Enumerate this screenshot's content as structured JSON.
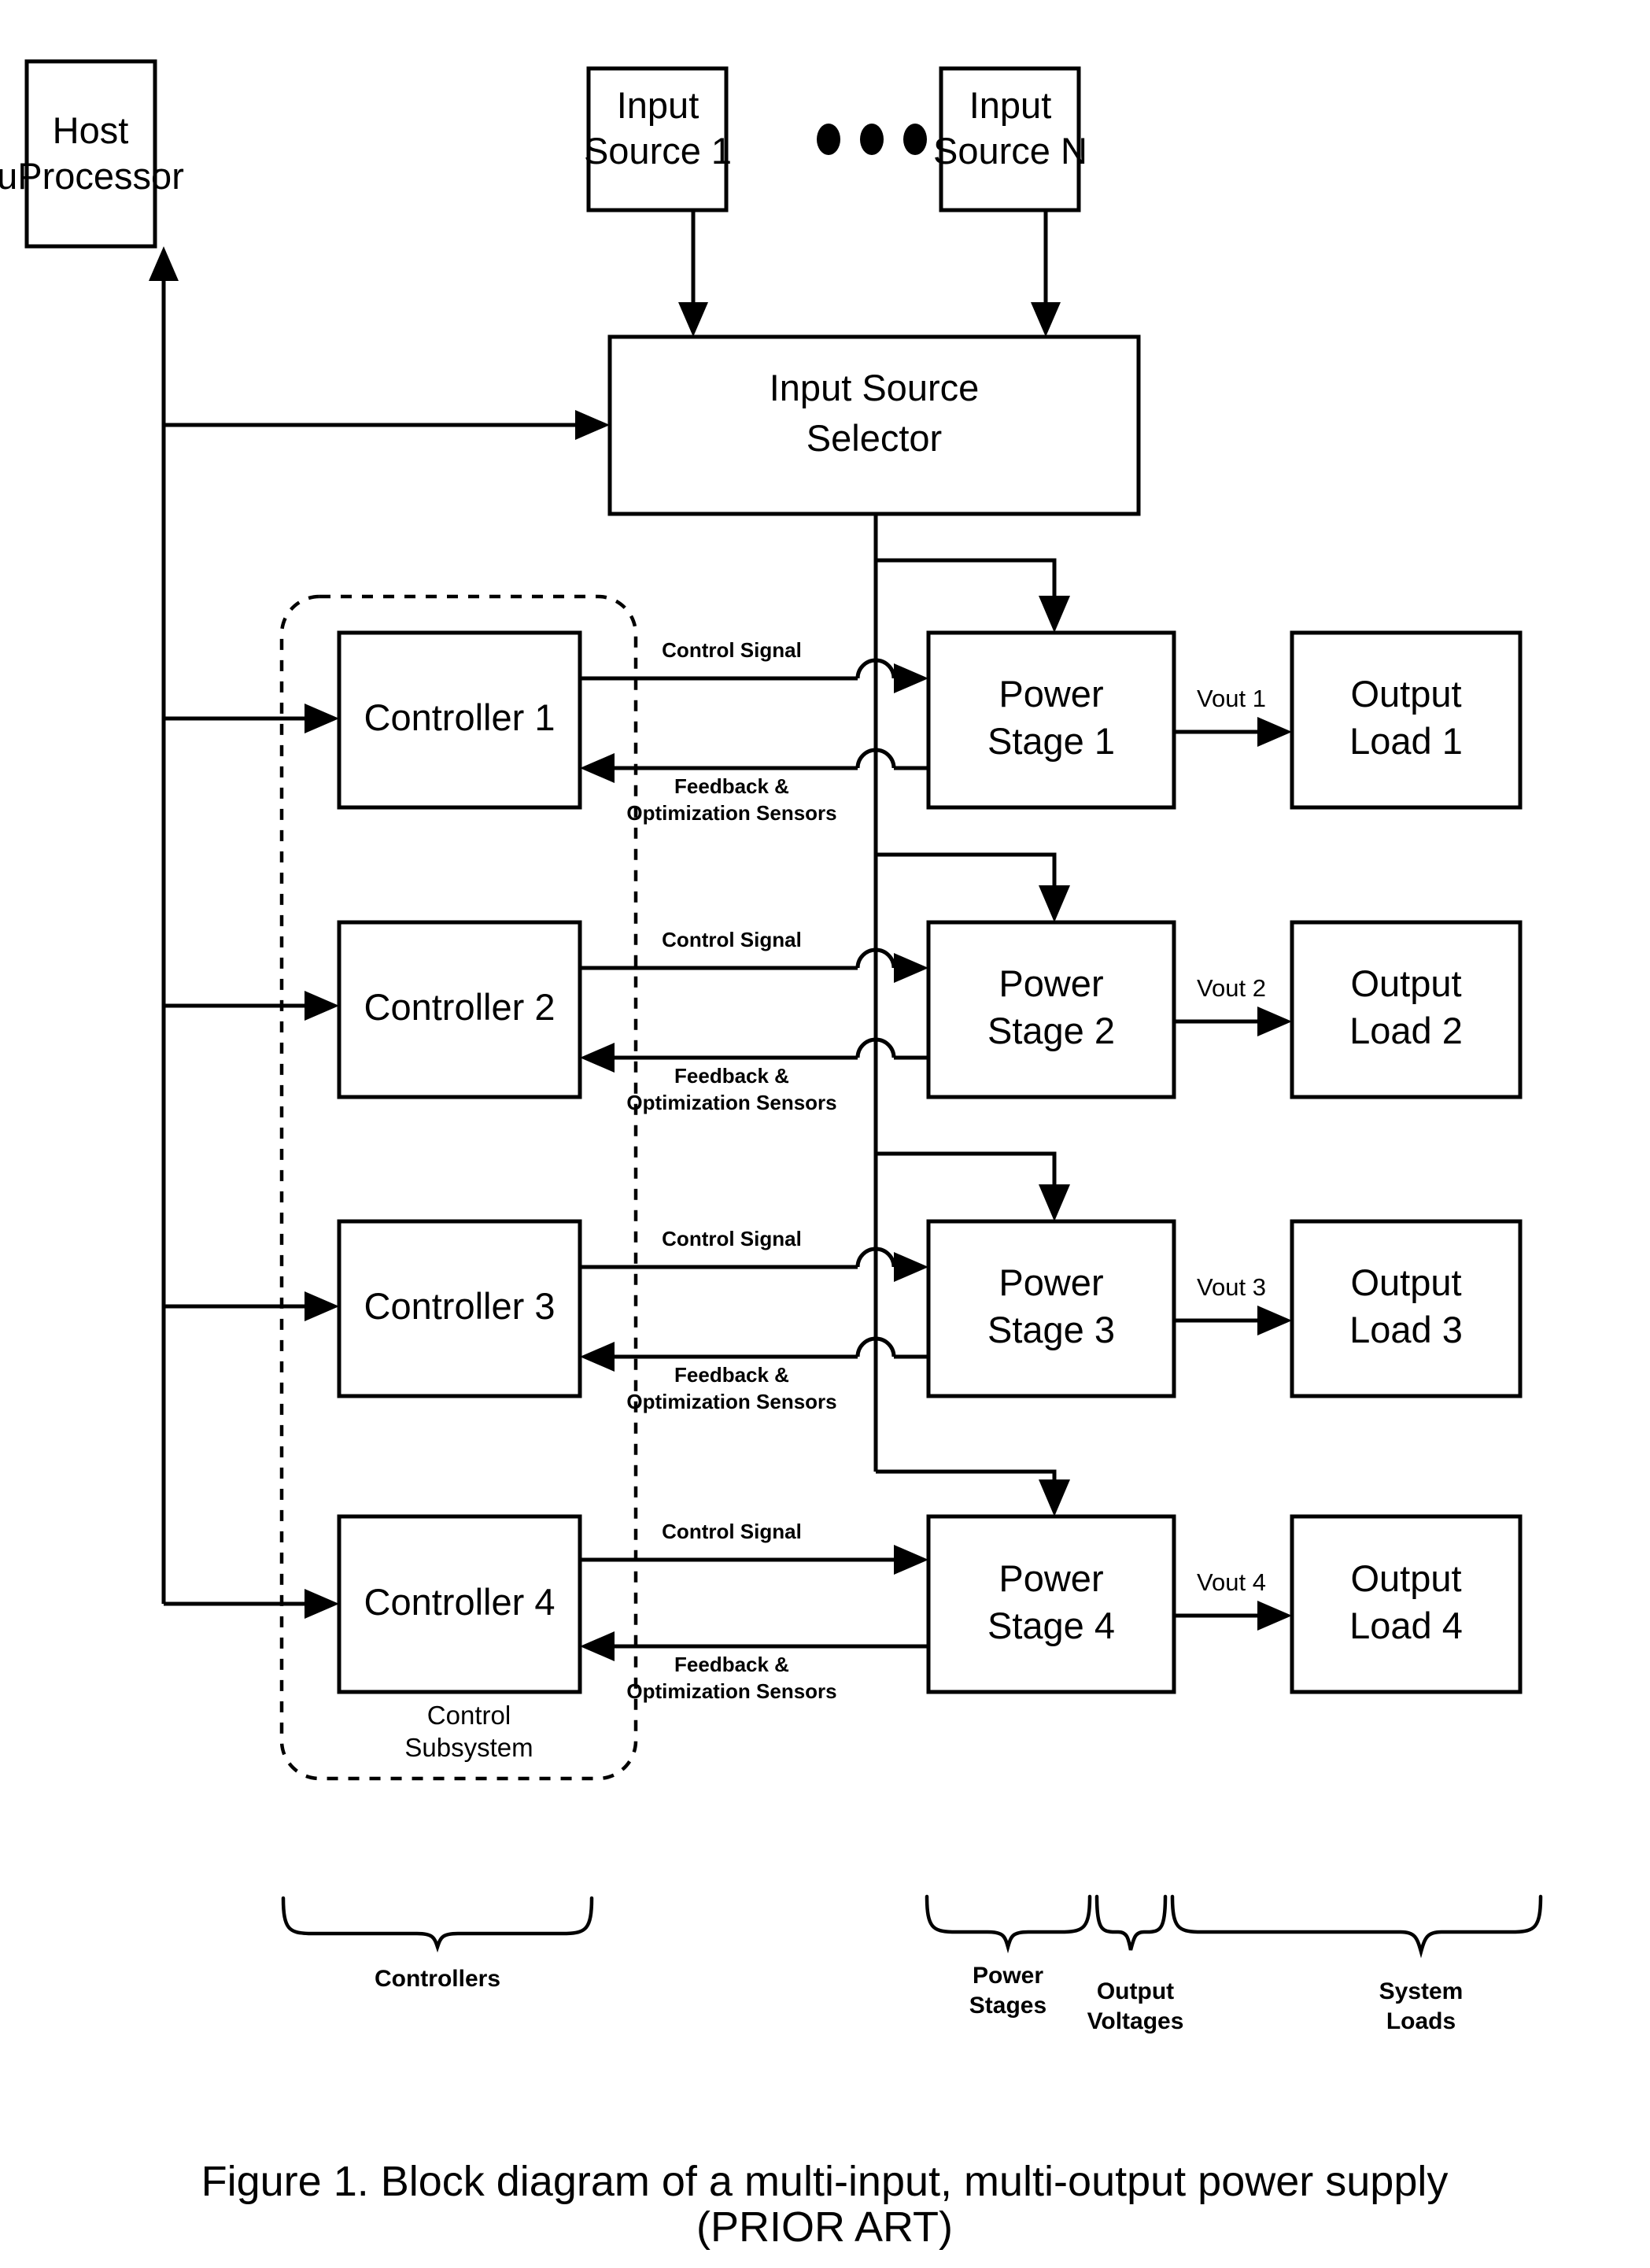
{
  "figure": {
    "caption_line1": "Figure 1.  Block diagram of a multi-input, multi-output power supply",
    "caption_line2": "(PRIOR ART)"
  },
  "blocks": {
    "host": {
      "line1": "Host",
      "line2": "uProcessor"
    },
    "input_source_first": {
      "line1": "Input",
      "line2": "Source 1"
    },
    "input_source_last": {
      "line1": "Input",
      "line2": "Source N"
    },
    "selector": {
      "line1": "Input Source",
      "line2": "Selector"
    },
    "ellipsis": "• • •"
  },
  "channels": [
    {
      "controller": "Controller 1",
      "power_stage_line1": "Power",
      "power_stage_line2": "Stage 1",
      "output_load_line1": "Output",
      "output_load_line2": "Load 1",
      "vout": "Vout 1",
      "control_signal": "Control Signal",
      "feedback_line1": "Feedback &",
      "feedback_line2": "Optimization Sensors"
    },
    {
      "controller": "Controller 2",
      "power_stage_line1": "Power",
      "power_stage_line2": "Stage 2",
      "output_load_line1": "Output",
      "output_load_line2": "Load 2",
      "vout": "Vout 2",
      "control_signal": "Control Signal",
      "feedback_line1": "Feedback &",
      "feedback_line2": "Optimization Sensors"
    },
    {
      "controller": "Controller 3",
      "power_stage_line1": "Power",
      "power_stage_line2": "Stage 3",
      "output_load_line1": "Output",
      "output_load_line2": "Load 3",
      "vout": "Vout 3",
      "control_signal": "Control Signal",
      "feedback_line1": "Feedback &",
      "feedback_line2": "Optimization Sensors"
    },
    {
      "controller": "Controller 4",
      "power_stage_line1": "Power",
      "power_stage_line2": "Stage 4",
      "output_load_line1": "Output",
      "output_load_line2": "Load 4",
      "vout": "Vout 4",
      "control_signal": "Control Signal",
      "feedback_line1": "Feedback &",
      "feedback_line2": "Optimization Sensors"
    }
  ],
  "subsystem": {
    "line1": "Control",
    "line2": "Subsystem"
  },
  "group_braces": [
    {
      "line1": "Controllers",
      "line2": ""
    },
    {
      "line1": "Power",
      "line2": "Stages"
    },
    {
      "line1": "Output",
      "line2": "Voltages"
    },
    {
      "line1": "System",
      "line2": "Loads"
    }
  ],
  "colors": {
    "ink": "#000000",
    "paper": "#ffffff"
  }
}
